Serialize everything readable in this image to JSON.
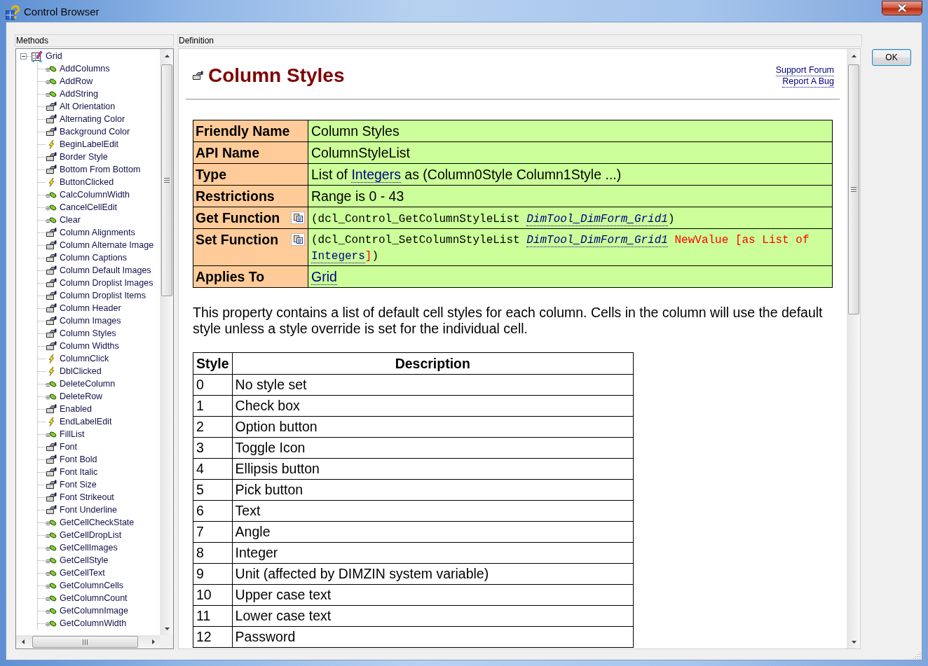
{
  "window": {
    "title": "Control Browser"
  },
  "methods_panel": {
    "header": "Methods",
    "tree": [
      {
        "label": "Grid",
        "kind": "control",
        "expanded": true,
        "children": [
          {
            "label": "AddColumns",
            "kind": "method"
          },
          {
            "label": "AddRow",
            "kind": "method"
          },
          {
            "label": "AddString",
            "kind": "method"
          },
          {
            "label": "Alt Orientation",
            "kind": "property"
          },
          {
            "label": "Alternating Color",
            "kind": "property"
          },
          {
            "label": "Background Color",
            "kind": "property"
          },
          {
            "label": "BeginLabelEdit",
            "kind": "event"
          },
          {
            "label": "Border Style",
            "kind": "property"
          },
          {
            "label": "Bottom From Bottom",
            "kind": "property"
          },
          {
            "label": "ButtonClicked",
            "kind": "event"
          },
          {
            "label": "CalcColumnWidth",
            "kind": "method"
          },
          {
            "label": "CancelCellEdit",
            "kind": "method"
          },
          {
            "label": "Clear",
            "kind": "method"
          },
          {
            "label": "Column Alignments",
            "kind": "property"
          },
          {
            "label": "Column Alternate Image",
            "kind": "property"
          },
          {
            "label": "Column Captions",
            "kind": "property"
          },
          {
            "label": "Column Default Images",
            "kind": "property"
          },
          {
            "label": "Column Droplist Images",
            "kind": "property"
          },
          {
            "label": "Column Droplist Items",
            "kind": "property"
          },
          {
            "label": "Column Header",
            "kind": "property"
          },
          {
            "label": "Column Images",
            "kind": "property"
          },
          {
            "label": "Column Styles",
            "kind": "property"
          },
          {
            "label": "Column Widths",
            "kind": "property"
          },
          {
            "label": "ColumnClick",
            "kind": "event"
          },
          {
            "label": "DblClicked",
            "kind": "event"
          },
          {
            "label": "DeleteColumn",
            "kind": "method"
          },
          {
            "label": "DeleteRow",
            "kind": "method"
          },
          {
            "label": "Enabled",
            "kind": "property"
          },
          {
            "label": "EndLabelEdit",
            "kind": "event"
          },
          {
            "label": "FillList",
            "kind": "method"
          },
          {
            "label": "Font",
            "kind": "property"
          },
          {
            "label": "Font Bold",
            "kind": "property"
          },
          {
            "label": "Font Italic",
            "kind": "property"
          },
          {
            "label": "Font Size",
            "kind": "property"
          },
          {
            "label": "Font Strikeout",
            "kind": "property"
          },
          {
            "label": "Font Underline",
            "kind": "property"
          },
          {
            "label": "GetCellCheckState",
            "kind": "method"
          },
          {
            "label": "GetCellDropList",
            "kind": "method"
          },
          {
            "label": "GetCellImages",
            "kind": "method"
          },
          {
            "label": "GetCellStyle",
            "kind": "method"
          },
          {
            "label": "GetCellText",
            "kind": "method"
          },
          {
            "label": "GetColumnCells",
            "kind": "method"
          },
          {
            "label": "GetColumnCount",
            "kind": "method"
          },
          {
            "label": "GetColumnImage",
            "kind": "method"
          },
          {
            "label": "GetColumnWidth",
            "kind": "method"
          }
        ]
      }
    ]
  },
  "definition_panel": {
    "header": "Definition",
    "title": "Column Styles",
    "links": [
      "Support Forum",
      "Report A Bug"
    ],
    "properties": [
      {
        "label": "Friendly Name",
        "kind": "text",
        "value": [
          {
            "kind": "text",
            "text": "Column Styles"
          }
        ]
      },
      {
        "label": "API Name",
        "kind": "text",
        "value": [
          {
            "kind": "text",
            "text": "ColumnStyleList"
          }
        ]
      },
      {
        "label": "Type",
        "kind": "text",
        "value": [
          {
            "kind": "text",
            "text": "List of "
          },
          {
            "kind": "link",
            "text": "Integers"
          },
          {
            "kind": "text",
            "text": " as (Column0Style Column1Style ...)"
          }
        ]
      },
      {
        "label": "Restrictions",
        "kind": "text",
        "value": [
          {
            "kind": "text",
            "text": "Range is 0 - 43"
          }
        ]
      },
      {
        "label": "Get Function",
        "kind": "code",
        "value": [
          {
            "kind": "text",
            "text": "(dcl_Control_GetColumnStyleList "
          },
          {
            "kind": "object_link",
            "text": "DimTool_DimForm_Grid1"
          },
          {
            "kind": "text",
            "text": ")"
          }
        ]
      },
      {
        "label": "Set Function",
        "kind": "code",
        "value": [
          {
            "kind": "text",
            "text": "(dcl_Control_SetColumnStyleList "
          },
          {
            "kind": "object_link",
            "text": "DimTool_DimForm_Grid1"
          },
          {
            "kind": "argument",
            "text": " NewValue [as List of "
          },
          {
            "kind": "link",
            "text": "Integers"
          },
          {
            "kind": "argument",
            "text": "]"
          },
          {
            "kind": "text",
            "text": ")"
          }
        ]
      },
      {
        "label": "Applies To",
        "kind": "text",
        "value": [
          {
            "kind": "link",
            "text": "Grid"
          }
        ]
      }
    ],
    "description": "This property contains a list of default cell styles for each column. Cells in the column will use the default style unless a style override is set for the individual cell.",
    "styles_table": {
      "columns": [
        "Style",
        "Description"
      ],
      "rows": [
        [
          "0",
          "No style set"
        ],
        [
          "1",
          "Check box"
        ],
        [
          "2",
          "Option button"
        ],
        [
          "3",
          "Toggle Icon"
        ],
        [
          "4",
          "Ellipsis button"
        ],
        [
          "5",
          "Pick button"
        ],
        [
          "6",
          "Text"
        ],
        [
          "7",
          "Angle"
        ],
        [
          "8",
          "Integer"
        ],
        [
          "9",
          "Unit (affected by DIMZIN system variable)"
        ],
        [
          "10",
          "Upper case text"
        ],
        [
          "11",
          "Lower case text"
        ],
        [
          "12",
          "Password"
        ]
      ]
    }
  },
  "buttons": [
    "OK"
  ]
}
